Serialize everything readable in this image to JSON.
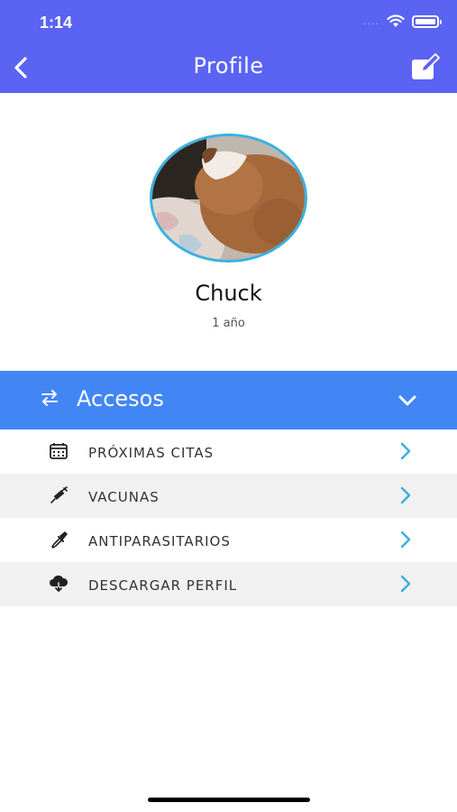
{
  "status_bar": {
    "time": "1:14",
    "signal": "...."
  },
  "header": {
    "title": "Profile",
    "accent": "#5b63f3"
  },
  "profile": {
    "name": "Chuck",
    "age": "1 año"
  },
  "accesos": {
    "label": "Accesos",
    "bar_color": "#4286f5",
    "expanded": true
  },
  "menu": {
    "items": [
      {
        "label": "PRÓXIMAS CITAS",
        "icon": "calendar-icon"
      },
      {
        "label": "VACUNAS",
        "icon": "syringe-icon"
      },
      {
        "label": "ANTIPARASITARIOS",
        "icon": "dropper-icon"
      },
      {
        "label": "DESCARGAR PERFIL",
        "icon": "cloud-download-icon"
      }
    ],
    "chevron_color": "#3ab1e0"
  }
}
